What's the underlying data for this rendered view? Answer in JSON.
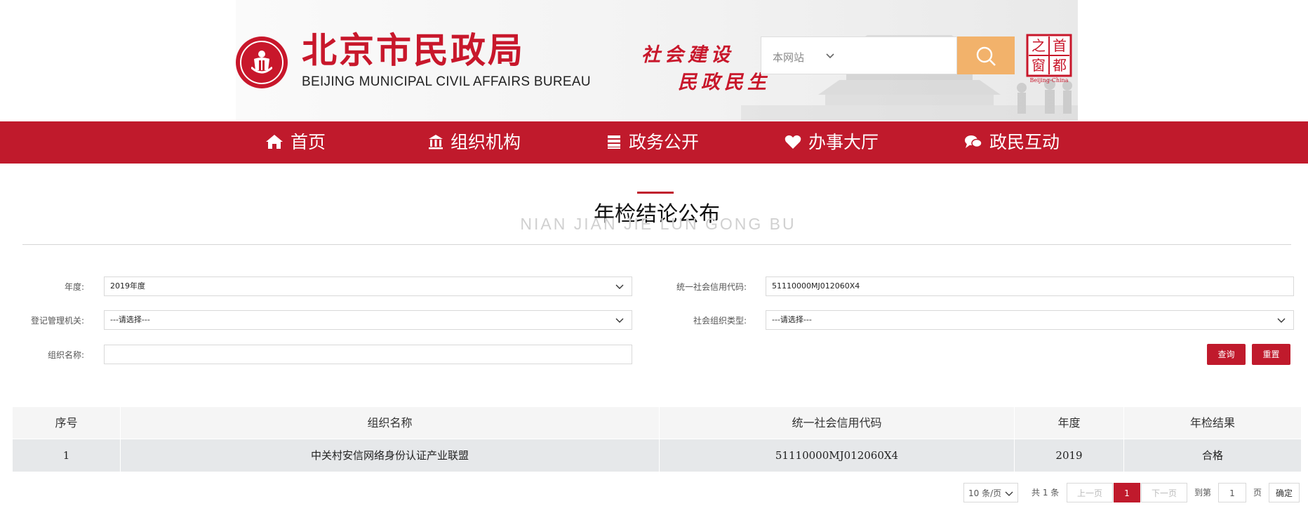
{
  "header": {
    "logo_cn": "北京市民政局",
    "logo_en": "BEIJING MUNICIPAL CIVIL AFFAIRS BUREAU",
    "slogan_line1": "社会建设",
    "slogan_line2": "民政民生",
    "search_scope": "本网站",
    "search_scope_placeholder": "",
    "badge_chars": [
      "首",
      "都",
      "之",
      "窗"
    ],
    "badge_en": "Beijing-China"
  },
  "nav": {
    "items": [
      {
        "label": "首页",
        "icon": "home-icon"
      },
      {
        "label": "组织机构",
        "icon": "institution-icon"
      },
      {
        "label": "政务公开",
        "icon": "book-icon"
      },
      {
        "label": "办事大厅",
        "icon": "heart-icon"
      },
      {
        "label": "政民互动",
        "icon": "chat-icon"
      }
    ]
  },
  "page": {
    "title": "年检结论公布",
    "subtitle": "NIAN JIAN JIE LUN GONG BU"
  },
  "filters": {
    "year_label": "年度:",
    "year_value": "2019年度",
    "credit_code_label": "统一社会信用代码:",
    "credit_code_value": "51110000MJ012060X4",
    "registry_label": "登记管理机关:",
    "registry_value": "---请选择---",
    "org_type_label": "社会组织类型:",
    "org_type_value": "---请选择---",
    "org_name_label": "组织名称:",
    "org_name_value": "",
    "query_button": "查询",
    "reset_button": "重置"
  },
  "table": {
    "headers": [
      "序号",
      "组织名称",
      "统一社会信用代码",
      "年度",
      "年检结果"
    ],
    "rows": [
      [
        "1",
        "中关村安信网络身份认证产业联盟",
        "51110000MJ012060X4",
        "2019",
        "合格"
      ]
    ]
  },
  "pagination": {
    "page_size": "10 条/页",
    "total": "共 1 条",
    "prev": "上一页",
    "current": "1",
    "next": "下一页",
    "goto_label": "到第",
    "goto_value": "1",
    "page_unit": "页",
    "confirm": "确定"
  },
  "colors": {
    "brand_red": "#c01a2c",
    "search_orange": "#f2b26b"
  }
}
